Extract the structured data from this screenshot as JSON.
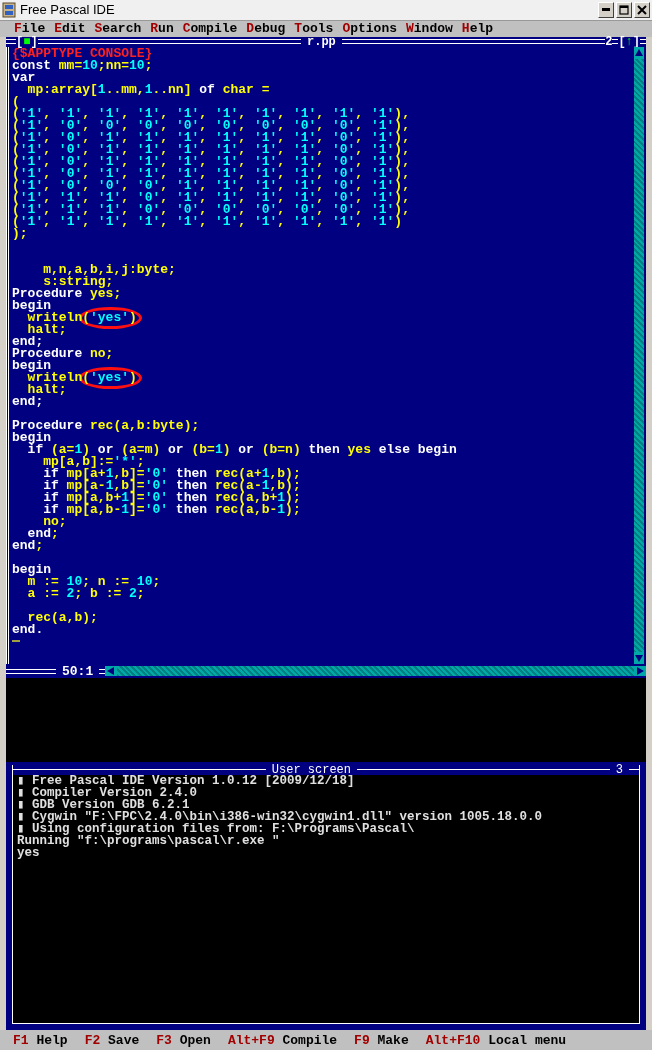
{
  "window": {
    "title": "Free Pascal IDE"
  },
  "menu": [
    "File",
    "Edit",
    "Search",
    "Run",
    "Compile",
    "Debug",
    "Tools",
    "Options",
    "Window",
    "Help"
  ],
  "editor": {
    "title": "r.pp",
    "close_button": {
      "left": "[",
      "glyph": "■",
      "right": "]"
    },
    "number": "2",
    "zoom_button": {
      "left": "[",
      "glyph": "↑",
      "right": "]"
    },
    "position": "50:1",
    "lines": [
      {
        "kind": "code",
        "segments": [
          {
            "kind": "dir",
            "text": "{$APPTYPE CONSOLE}"
          }
        ]
      },
      {
        "kind": "code",
        "segments": [
          {
            "kind": "kw",
            "text": "const "
          },
          {
            "kind": "id",
            "text": "mm="
          },
          {
            "kind": "num",
            "text": "10"
          },
          {
            "kind": "id",
            "text": ";nn="
          },
          {
            "kind": "num",
            "text": "10"
          },
          {
            "kind": "id",
            "text": ";"
          }
        ]
      },
      {
        "kind": "code",
        "segments": [
          {
            "kind": "kw",
            "text": "var"
          }
        ]
      },
      {
        "kind": "code",
        "segments": [
          {
            "kind": "id",
            "text": "  mp:array["
          },
          {
            "kind": "num",
            "text": "1"
          },
          {
            "kind": "id",
            "text": "..mm,"
          },
          {
            "kind": "num",
            "text": "1"
          },
          {
            "kind": "id",
            "text": "..nn] "
          },
          {
            "kind": "kw",
            "text": "of "
          },
          {
            "kind": "id",
            "text": "char ="
          }
        ]
      },
      {
        "kind": "code",
        "segments": [
          {
            "kind": "id",
            "text": "("
          }
        ]
      },
      {
        "kind": "code",
        "segments": [
          {
            "kind": "id",
            "text": "("
          },
          {
            "kind": "num",
            "text": "'1'"
          },
          {
            "kind": "id",
            "text": ", "
          },
          {
            "kind": "num",
            "text": "'1'"
          },
          {
            "kind": "id",
            "text": ", "
          },
          {
            "kind": "num",
            "text": "'1'"
          },
          {
            "kind": "id",
            "text": ", "
          },
          {
            "kind": "num",
            "text": "'1'"
          },
          {
            "kind": "id",
            "text": ", "
          },
          {
            "kind": "num",
            "text": "'1'"
          },
          {
            "kind": "id",
            "text": ", "
          },
          {
            "kind": "num",
            "text": "'1'"
          },
          {
            "kind": "id",
            "text": ", "
          },
          {
            "kind": "num",
            "text": "'1'"
          },
          {
            "kind": "id",
            "text": ", "
          },
          {
            "kind": "num",
            "text": "'1'"
          },
          {
            "kind": "id",
            "text": ", "
          },
          {
            "kind": "num",
            "text": "'1'"
          },
          {
            "kind": "id",
            "text": ", "
          },
          {
            "kind": "num",
            "text": "'1'"
          },
          {
            "kind": "id",
            "text": "),"
          }
        ]
      },
      {
        "kind": "code",
        "segments": [
          {
            "kind": "id",
            "text": "("
          },
          {
            "kind": "num",
            "text": "'1'"
          },
          {
            "kind": "id",
            "text": ", "
          },
          {
            "kind": "num",
            "text": "'0'"
          },
          {
            "kind": "id",
            "text": ", "
          },
          {
            "kind": "num",
            "text": "'0'"
          },
          {
            "kind": "id",
            "text": ", "
          },
          {
            "kind": "num",
            "text": "'0'"
          },
          {
            "kind": "id",
            "text": ", "
          },
          {
            "kind": "num",
            "text": "'0'"
          },
          {
            "kind": "id",
            "text": ", "
          },
          {
            "kind": "num",
            "text": "'0'"
          },
          {
            "kind": "id",
            "text": ", "
          },
          {
            "kind": "num",
            "text": "'0'"
          },
          {
            "kind": "id",
            "text": ", "
          },
          {
            "kind": "num",
            "text": "'0'"
          },
          {
            "kind": "id",
            "text": ", "
          },
          {
            "kind": "num",
            "text": "'0'"
          },
          {
            "kind": "id",
            "text": ", "
          },
          {
            "kind": "num",
            "text": "'1'"
          },
          {
            "kind": "id",
            "text": "),"
          }
        ]
      },
      {
        "kind": "code",
        "segments": [
          {
            "kind": "id",
            "text": "("
          },
          {
            "kind": "num",
            "text": "'1'"
          },
          {
            "kind": "id",
            "text": ", "
          },
          {
            "kind": "num",
            "text": "'0'"
          },
          {
            "kind": "id",
            "text": ", "
          },
          {
            "kind": "num",
            "text": "'1'"
          },
          {
            "kind": "id",
            "text": ", "
          },
          {
            "kind": "num",
            "text": "'1'"
          },
          {
            "kind": "id",
            "text": ", "
          },
          {
            "kind": "num",
            "text": "'1'"
          },
          {
            "kind": "id",
            "text": ", "
          },
          {
            "kind": "num",
            "text": "'1'"
          },
          {
            "kind": "id",
            "text": ", "
          },
          {
            "kind": "num",
            "text": "'1'"
          },
          {
            "kind": "id",
            "text": ", "
          },
          {
            "kind": "num",
            "text": "'1'"
          },
          {
            "kind": "id",
            "text": ", "
          },
          {
            "kind": "num",
            "text": "'0'"
          },
          {
            "kind": "id",
            "text": ", "
          },
          {
            "kind": "num",
            "text": "'1'"
          },
          {
            "kind": "id",
            "text": "),"
          }
        ]
      },
      {
        "kind": "code",
        "segments": [
          {
            "kind": "id",
            "text": "("
          },
          {
            "kind": "num",
            "text": "'1'"
          },
          {
            "kind": "id",
            "text": ", "
          },
          {
            "kind": "num",
            "text": "'0'"
          },
          {
            "kind": "id",
            "text": ", "
          },
          {
            "kind": "num",
            "text": "'1'"
          },
          {
            "kind": "id",
            "text": ", "
          },
          {
            "kind": "num",
            "text": "'1'"
          },
          {
            "kind": "id",
            "text": ", "
          },
          {
            "kind": "num",
            "text": "'1'"
          },
          {
            "kind": "id",
            "text": ", "
          },
          {
            "kind": "num",
            "text": "'1'"
          },
          {
            "kind": "id",
            "text": ", "
          },
          {
            "kind": "num",
            "text": "'1'"
          },
          {
            "kind": "id",
            "text": ", "
          },
          {
            "kind": "num",
            "text": "'1'"
          },
          {
            "kind": "id",
            "text": ", "
          },
          {
            "kind": "num",
            "text": "'0'"
          },
          {
            "kind": "id",
            "text": ", "
          },
          {
            "kind": "num",
            "text": "'1'"
          },
          {
            "kind": "id",
            "text": "),"
          }
        ]
      },
      {
        "kind": "code",
        "segments": [
          {
            "kind": "id",
            "text": "("
          },
          {
            "kind": "num",
            "text": "'1'"
          },
          {
            "kind": "id",
            "text": ", "
          },
          {
            "kind": "num",
            "text": "'0'"
          },
          {
            "kind": "id",
            "text": ", "
          },
          {
            "kind": "num",
            "text": "'1'"
          },
          {
            "kind": "id",
            "text": ", "
          },
          {
            "kind": "num",
            "text": "'1'"
          },
          {
            "kind": "id",
            "text": ", "
          },
          {
            "kind": "num",
            "text": "'1'"
          },
          {
            "kind": "id",
            "text": ", "
          },
          {
            "kind": "num",
            "text": "'1'"
          },
          {
            "kind": "id",
            "text": ", "
          },
          {
            "kind": "num",
            "text": "'1'"
          },
          {
            "kind": "id",
            "text": ", "
          },
          {
            "kind": "num",
            "text": "'1'"
          },
          {
            "kind": "id",
            "text": ", "
          },
          {
            "kind": "num",
            "text": "'0'"
          },
          {
            "kind": "id",
            "text": ", "
          },
          {
            "kind": "num",
            "text": "'1'"
          },
          {
            "kind": "id",
            "text": "),"
          }
        ]
      },
      {
        "kind": "code",
        "segments": [
          {
            "kind": "id",
            "text": "("
          },
          {
            "kind": "num",
            "text": "'1'"
          },
          {
            "kind": "id",
            "text": ", "
          },
          {
            "kind": "num",
            "text": "'0'"
          },
          {
            "kind": "id",
            "text": ", "
          },
          {
            "kind": "num",
            "text": "'1'"
          },
          {
            "kind": "id",
            "text": ", "
          },
          {
            "kind": "num",
            "text": "'1'"
          },
          {
            "kind": "id",
            "text": ", "
          },
          {
            "kind": "num",
            "text": "'1'"
          },
          {
            "kind": "id",
            "text": ", "
          },
          {
            "kind": "num",
            "text": "'1'"
          },
          {
            "kind": "id",
            "text": ", "
          },
          {
            "kind": "num",
            "text": "'1'"
          },
          {
            "kind": "id",
            "text": ", "
          },
          {
            "kind": "num",
            "text": "'1'"
          },
          {
            "kind": "id",
            "text": ", "
          },
          {
            "kind": "num",
            "text": "'0'"
          },
          {
            "kind": "id",
            "text": ", "
          },
          {
            "kind": "num",
            "text": "'1'"
          },
          {
            "kind": "id",
            "text": "),"
          }
        ]
      },
      {
        "kind": "code",
        "segments": [
          {
            "kind": "id",
            "text": "("
          },
          {
            "kind": "num",
            "text": "'1'"
          },
          {
            "kind": "id",
            "text": ", "
          },
          {
            "kind": "num",
            "text": "'0'"
          },
          {
            "kind": "id",
            "text": ", "
          },
          {
            "kind": "num",
            "text": "'0'"
          },
          {
            "kind": "id",
            "text": ", "
          },
          {
            "kind": "num",
            "text": "'0'"
          },
          {
            "kind": "id",
            "text": ", "
          },
          {
            "kind": "num",
            "text": "'1'"
          },
          {
            "kind": "id",
            "text": ", "
          },
          {
            "kind": "num",
            "text": "'1'"
          },
          {
            "kind": "id",
            "text": ", "
          },
          {
            "kind": "num",
            "text": "'1'"
          },
          {
            "kind": "id",
            "text": ", "
          },
          {
            "kind": "num",
            "text": "'1'"
          },
          {
            "kind": "id",
            "text": ", "
          },
          {
            "kind": "num",
            "text": "'0'"
          },
          {
            "kind": "id",
            "text": ", "
          },
          {
            "kind": "num",
            "text": "'1'"
          },
          {
            "kind": "id",
            "text": "),"
          }
        ]
      },
      {
        "kind": "code",
        "segments": [
          {
            "kind": "id",
            "text": "("
          },
          {
            "kind": "num",
            "text": "'1'"
          },
          {
            "kind": "id",
            "text": ", "
          },
          {
            "kind": "num",
            "text": "'1'"
          },
          {
            "kind": "id",
            "text": ", "
          },
          {
            "kind": "num",
            "text": "'1'"
          },
          {
            "kind": "id",
            "text": ", "
          },
          {
            "kind": "num",
            "text": "'0'"
          },
          {
            "kind": "id",
            "text": ", "
          },
          {
            "kind": "num",
            "text": "'1'"
          },
          {
            "kind": "id",
            "text": ", "
          },
          {
            "kind": "num",
            "text": "'1'"
          },
          {
            "kind": "id",
            "text": ", "
          },
          {
            "kind": "num",
            "text": "'1'"
          },
          {
            "kind": "id",
            "text": ", "
          },
          {
            "kind": "num",
            "text": "'1'"
          },
          {
            "kind": "id",
            "text": ", "
          },
          {
            "kind": "num",
            "text": "'0'"
          },
          {
            "kind": "id",
            "text": ", "
          },
          {
            "kind": "num",
            "text": "'1'"
          },
          {
            "kind": "id",
            "text": "),"
          }
        ]
      },
      {
        "kind": "code",
        "segments": [
          {
            "kind": "id",
            "text": "("
          },
          {
            "kind": "num",
            "text": "'1'"
          },
          {
            "kind": "id",
            "text": ", "
          },
          {
            "kind": "num",
            "text": "'1'"
          },
          {
            "kind": "id",
            "text": ", "
          },
          {
            "kind": "num",
            "text": "'1'"
          },
          {
            "kind": "id",
            "text": ", "
          },
          {
            "kind": "num",
            "text": "'0'"
          },
          {
            "kind": "id",
            "text": ", "
          },
          {
            "kind": "num",
            "text": "'0'"
          },
          {
            "kind": "id",
            "text": ", "
          },
          {
            "kind": "num",
            "text": "'0'"
          },
          {
            "kind": "id",
            "text": ", "
          },
          {
            "kind": "num",
            "text": "'0'"
          },
          {
            "kind": "id",
            "text": ", "
          },
          {
            "kind": "num",
            "text": "'0'"
          },
          {
            "kind": "id",
            "text": ", "
          },
          {
            "kind": "num",
            "text": "'0'"
          },
          {
            "kind": "id",
            "text": ", "
          },
          {
            "kind": "num",
            "text": "'1'"
          },
          {
            "kind": "id",
            "text": "),"
          }
        ]
      },
      {
        "kind": "code",
        "segments": [
          {
            "kind": "id",
            "text": "("
          },
          {
            "kind": "num",
            "text": "'1'"
          },
          {
            "kind": "id",
            "text": ", "
          },
          {
            "kind": "num",
            "text": "'1'"
          },
          {
            "kind": "id",
            "text": ", "
          },
          {
            "kind": "num",
            "text": "'1'"
          },
          {
            "kind": "id",
            "text": ", "
          },
          {
            "kind": "num",
            "text": "'1'"
          },
          {
            "kind": "id",
            "text": ", "
          },
          {
            "kind": "num",
            "text": "'1'"
          },
          {
            "kind": "id",
            "text": ", "
          },
          {
            "kind": "num",
            "text": "'1'"
          },
          {
            "kind": "id",
            "text": ", "
          },
          {
            "kind": "num",
            "text": "'1'"
          },
          {
            "kind": "id",
            "text": ", "
          },
          {
            "kind": "num",
            "text": "'1'"
          },
          {
            "kind": "id",
            "text": ", "
          },
          {
            "kind": "num",
            "text": "'1'"
          },
          {
            "kind": "id",
            "text": ", "
          },
          {
            "kind": "num",
            "text": "'1'"
          },
          {
            "kind": "id",
            "text": ")"
          }
        ]
      },
      {
        "kind": "code",
        "segments": [
          {
            "kind": "id",
            "text": ");"
          }
        ]
      },
      {
        "kind": "blank"
      },
      {
        "kind": "blank"
      },
      {
        "kind": "code",
        "segments": [
          {
            "kind": "id",
            "text": "    m,n,a,b,i,j:byte;"
          }
        ]
      },
      {
        "kind": "code",
        "segments": [
          {
            "kind": "id",
            "text": "    s:string;"
          }
        ]
      },
      {
        "kind": "code",
        "segments": [
          {
            "kind": "kw",
            "text": "Procedure "
          },
          {
            "kind": "id",
            "text": "yes;"
          }
        ]
      },
      {
        "kind": "code",
        "segments": [
          {
            "kind": "kw",
            "text": "begin"
          }
        ]
      },
      {
        "kind": "code",
        "circled": true,
        "segments": [
          {
            "kind": "id",
            "text": "  writeln("
          },
          {
            "kind": "num",
            "text": "'yes'"
          },
          {
            "kind": "id",
            "text": ")"
          }
        ]
      },
      {
        "kind": "code",
        "segments": [
          {
            "kind": "id",
            "text": "  halt;"
          }
        ]
      },
      {
        "kind": "code",
        "segments": [
          {
            "kind": "kw",
            "text": "end;"
          }
        ]
      },
      {
        "kind": "code",
        "segments": [
          {
            "kind": "kw",
            "text": "Procedure "
          },
          {
            "kind": "id",
            "text": "no;"
          }
        ]
      },
      {
        "kind": "code",
        "segments": [
          {
            "kind": "kw",
            "text": "begin"
          }
        ]
      },
      {
        "kind": "code",
        "circled": true,
        "segments": [
          {
            "kind": "id",
            "text": "  writeln("
          },
          {
            "kind": "num",
            "text": "'yes'"
          },
          {
            "kind": "id",
            "text": ")"
          }
        ]
      },
      {
        "kind": "code",
        "segments": [
          {
            "kind": "id",
            "text": "  halt;"
          }
        ]
      },
      {
        "kind": "code",
        "segments": [
          {
            "kind": "kw",
            "text": "end;"
          }
        ]
      },
      {
        "kind": "blank"
      },
      {
        "kind": "code",
        "segments": [
          {
            "kind": "kw",
            "text": "Procedure "
          },
          {
            "kind": "id",
            "text": "rec(a,b:byte);"
          }
        ]
      },
      {
        "kind": "code",
        "segments": [
          {
            "kind": "kw",
            "text": "begin"
          }
        ]
      },
      {
        "kind": "code",
        "segments": [
          {
            "kind": "kw",
            "text": "  if "
          },
          {
            "kind": "id",
            "text": "(a="
          },
          {
            "kind": "num",
            "text": "1"
          },
          {
            "kind": "id",
            "text": ") "
          },
          {
            "kind": "kw",
            "text": "or "
          },
          {
            "kind": "id",
            "text": "(a=m) "
          },
          {
            "kind": "kw",
            "text": "or "
          },
          {
            "kind": "id",
            "text": "(b="
          },
          {
            "kind": "num",
            "text": "1"
          },
          {
            "kind": "id",
            "text": ") "
          },
          {
            "kind": "kw",
            "text": "or "
          },
          {
            "kind": "id",
            "text": "(b=n) "
          },
          {
            "kind": "kw",
            "text": "then "
          },
          {
            "kind": "id",
            "text": "yes "
          },
          {
            "kind": "kw",
            "text": "else begin"
          }
        ]
      },
      {
        "kind": "code",
        "segments": [
          {
            "kind": "id",
            "text": "    mp[a,b]:="
          },
          {
            "kind": "num",
            "text": "'*'"
          },
          {
            "kind": "id",
            "text": ";"
          }
        ]
      },
      {
        "kind": "code",
        "segments": [
          {
            "kind": "kw",
            "text": "    if "
          },
          {
            "kind": "id",
            "text": "mp[a+"
          },
          {
            "kind": "num",
            "text": "1"
          },
          {
            "kind": "id",
            "text": ",b]="
          },
          {
            "kind": "num",
            "text": "'0' "
          },
          {
            "kind": "kw",
            "text": "then "
          },
          {
            "kind": "id",
            "text": "rec(a+"
          },
          {
            "kind": "num",
            "text": "1"
          },
          {
            "kind": "id",
            "text": ",b);"
          }
        ]
      },
      {
        "kind": "code",
        "segments": [
          {
            "kind": "kw",
            "text": "    if "
          },
          {
            "kind": "id",
            "text": "mp[a-"
          },
          {
            "kind": "num",
            "text": "1"
          },
          {
            "kind": "id",
            "text": ",b]="
          },
          {
            "kind": "num",
            "text": "'0' "
          },
          {
            "kind": "kw",
            "text": "then "
          },
          {
            "kind": "id",
            "text": "rec(a-"
          },
          {
            "kind": "num",
            "text": "1"
          },
          {
            "kind": "id",
            "text": ",b);"
          }
        ]
      },
      {
        "kind": "code",
        "segments": [
          {
            "kind": "kw",
            "text": "    if "
          },
          {
            "kind": "id",
            "text": "mp[a,b+"
          },
          {
            "kind": "num",
            "text": "1"
          },
          {
            "kind": "id",
            "text": "]="
          },
          {
            "kind": "num",
            "text": "'0' "
          },
          {
            "kind": "kw",
            "text": "then "
          },
          {
            "kind": "id",
            "text": "rec(a,b+"
          },
          {
            "kind": "num",
            "text": "1"
          },
          {
            "kind": "id",
            "text": ");"
          }
        ]
      },
      {
        "kind": "code",
        "segments": [
          {
            "kind": "kw",
            "text": "    if "
          },
          {
            "kind": "id",
            "text": "mp[a,b-"
          },
          {
            "kind": "num",
            "text": "1"
          },
          {
            "kind": "id",
            "text": "]="
          },
          {
            "kind": "num",
            "text": "'0' "
          },
          {
            "kind": "kw",
            "text": "then "
          },
          {
            "kind": "id",
            "text": "rec(a,b-"
          },
          {
            "kind": "num",
            "text": "1"
          },
          {
            "kind": "id",
            "text": ");"
          }
        ]
      },
      {
        "kind": "code",
        "segments": [
          {
            "kind": "id",
            "text": "    no;"
          }
        ]
      },
      {
        "kind": "code",
        "segments": [
          {
            "kind": "kw",
            "text": "  end"
          },
          {
            "kind": "id",
            "text": ";"
          }
        ]
      },
      {
        "kind": "code",
        "segments": [
          {
            "kind": "kw",
            "text": "end"
          },
          {
            "kind": "id",
            "text": ";"
          }
        ]
      },
      {
        "kind": "blank"
      },
      {
        "kind": "code",
        "segments": [
          {
            "kind": "kw",
            "text": "begin"
          }
        ]
      },
      {
        "kind": "code",
        "segments": [
          {
            "kind": "id",
            "text": "  m := "
          },
          {
            "kind": "num",
            "text": "10"
          },
          {
            "kind": "id",
            "text": "; n := "
          },
          {
            "kind": "num",
            "text": "10"
          },
          {
            "kind": "id",
            "text": ";"
          }
        ]
      },
      {
        "kind": "code",
        "segments": [
          {
            "kind": "id",
            "text": "  a := "
          },
          {
            "kind": "num",
            "text": "2"
          },
          {
            "kind": "id",
            "text": "; b := "
          },
          {
            "kind": "num",
            "text": "2"
          },
          {
            "kind": "id",
            "text": ";"
          }
        ]
      },
      {
        "kind": "blank"
      },
      {
        "kind": "code",
        "segments": [
          {
            "kind": "id",
            "text": "  rec(a,b);"
          }
        ]
      },
      {
        "kind": "code",
        "segments": [
          {
            "kind": "kw",
            "text": "end."
          }
        ]
      },
      {
        "kind": "cursor"
      }
    ]
  },
  "user_screen": {
    "title": "User screen",
    "number": "3",
    "lines": [
      "▮ Free Pascal IDE Version 1.0.12 [2009/12/18]",
      "▮ Compiler Version 2.4.0",
      "▮ GDB Version GDB 6.2.1",
      "▮ Cygwin \"F:\\FPC\\2.4.0\\bin\\i386-win32\\cygwin1.dll\" version 1005.18.0.0",
      "▮ Using configuration files from: F:\\Programs\\Pascal\\",
      "Running \"f:\\programs\\pascal\\r.exe \"",
      "yes"
    ]
  },
  "status_bar": [
    {
      "key": "F1",
      "label": "Help"
    },
    {
      "key": "F2",
      "label": "Save"
    },
    {
      "key": "F3",
      "label": "Open"
    },
    {
      "key": "Alt+F9",
      "label": "Compile"
    },
    {
      "key": "F9",
      "label": "Make"
    },
    {
      "key": "Alt+F10",
      "label": "Local menu"
    }
  ]
}
